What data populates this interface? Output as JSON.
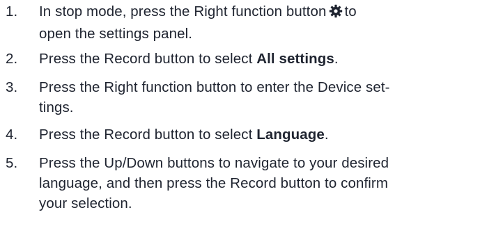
{
  "steps": [
    {
      "number": "1.",
      "lines": [
        {
          "text_before": "In stop mode, press the Right function button",
          "icon": "gear-icon",
          "text_after": "to"
        },
        {
          "text": "open the settings panel."
        }
      ]
    },
    {
      "number": "2.",
      "text_before": "Press the Record button to select ",
      "bold": "All settings",
      "text_after": "."
    },
    {
      "number": "3.",
      "lines": [
        {
          "text": "Press the Right function button to enter the Device set-"
        },
        {
          "text": "tings."
        }
      ]
    },
    {
      "number": "4.",
      "text_before": "Press the Record button to select ",
      "bold": "Language",
      "text_after": "."
    },
    {
      "number": "5.",
      "lines": [
        {
          "text": "Press the Up/Down buttons to navigate to your desired"
        },
        {
          "text": "language, and then press the Record button to confirm"
        },
        {
          "text": "your selection."
        }
      ]
    }
  ]
}
